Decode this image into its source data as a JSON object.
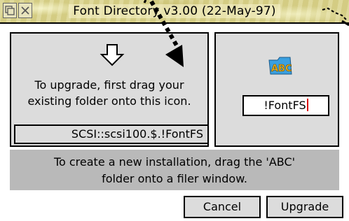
{
  "window": {
    "title": "Font Directory v3.00 (22-May-97)"
  },
  "upgrade_panel": {
    "instruction_line1": "To upgrade, first drag your",
    "instruction_line2": "existing folder onto this icon.",
    "path_value": "SCSI::scsi100.$.!FontFS"
  },
  "install_panel": {
    "icon_label": "ABC",
    "name_value": "!FontFS"
  },
  "info": {
    "line1": "To create a new installation, drag the 'ABC'",
    "line2": "folder onto a filer window."
  },
  "buttons": {
    "cancel": "Cancel",
    "upgrade": "Upgrade"
  },
  "icons": {
    "toolbox": "back-window-icon",
    "close": "close-icon",
    "arrow": "down-arrow-icon",
    "abc": "abc-folder-icon"
  }
}
